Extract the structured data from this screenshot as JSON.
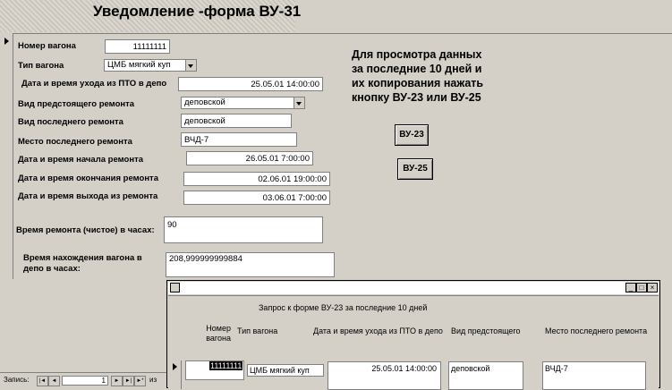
{
  "header": {
    "title": "Уведомление -форма ВУ-31"
  },
  "form": {
    "fields": [
      {
        "label": "Номер вагона",
        "value": "11111111"
      },
      {
        "label": "Тип вагона",
        "value": "ЦМБ мягкий куп"
      },
      {
        "label": "Дата и время ухода из ПТО в депо",
        "value": "25.05.01 14:00:00"
      },
      {
        "label": "Вид предстоящего ремонта",
        "value": "деповской"
      },
      {
        "label": "Вид последнего ремонта",
        "value": "деповской"
      },
      {
        "label": "Место последнего ремонта",
        "value": "ВЧД-7"
      },
      {
        "label": "Дата и время начала ремонта",
        "value": "26.05.01 7:00:00"
      },
      {
        "label": "Дата и время окончания ремонта",
        "value": "02.06.01 19:00:00"
      },
      {
        "label": "Дата и время выхода из ремонта",
        "value": "03.06.01 7:00:00"
      },
      {
        "label": "Время ремонта (чистое) в часах:",
        "value": "90"
      },
      {
        "label": "Время нахождения вагона в депо в часах:",
        "value": "208,999999999884"
      }
    ],
    "note_lines": [
      "Для просмотра данных",
      "за последние 10 дней и",
      "их копирования нажать",
      "кнопку ВУ-23 или ВУ-25"
    ],
    "btn_vu23": "ВУ-23",
    "btn_vu25": "ВУ-25"
  },
  "navigator": {
    "label": "Запись:",
    "current": "1",
    "of": "из"
  },
  "child_window": {
    "title": "Запрос к форме ВУ-23 за последние 10 дней",
    "columns": [
      "Номер вагона",
      "Тип вагона",
      "Дата и время ухода из ПТО в депо",
      "Вид предстоящего р",
      "Место последнего ремонта"
    ],
    "row": [
      "11111111",
      "ЦМБ мягкий куп",
      "25.05.01 14:00:00",
      "деповской",
      "ВЧД-7"
    ]
  }
}
